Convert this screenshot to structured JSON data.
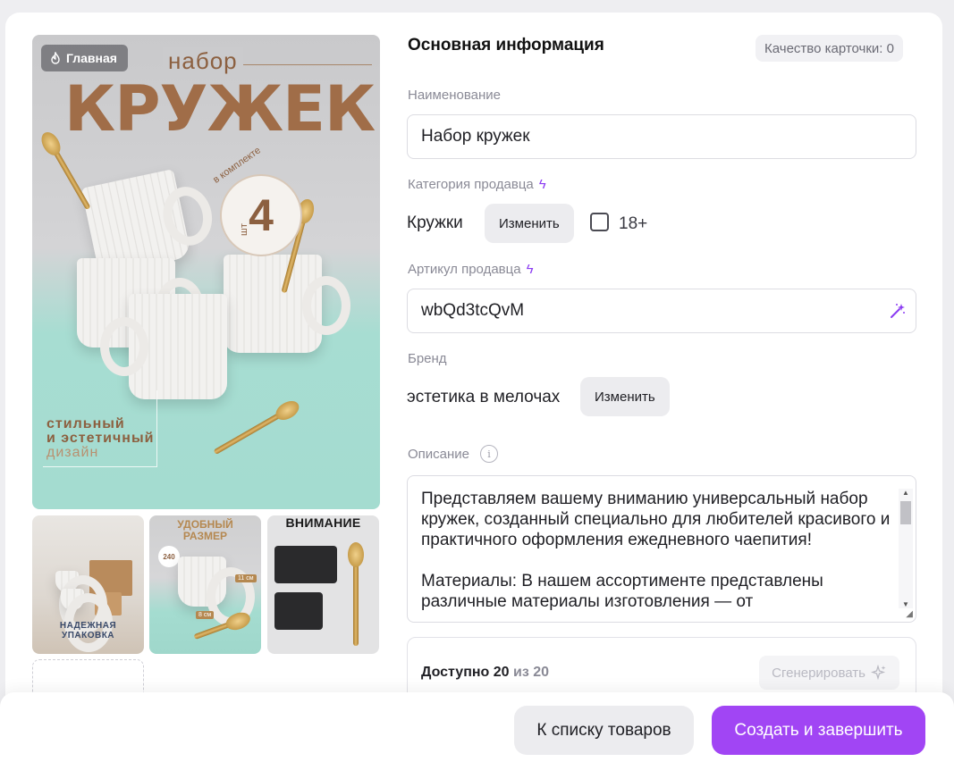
{
  "gallery": {
    "main_badge": "Главная",
    "promo": {
      "subtitle": "набор",
      "title": "КРУЖЕК",
      "count_arc": "в комплекте",
      "count_number": "4",
      "count_unit": "шт",
      "footer_line1": "стильный",
      "footer_line2": "и эстетичный",
      "footer_line3": "дизайн"
    },
    "thumbs": [
      {
        "caption": "НАДЕЖНАЯ УПАКОВКА"
      },
      {
        "caption_line1": "УДОБНЫЙ",
        "caption_line2": "РАЗМЕР",
        "dim1": "11 см",
        "dim2": "8 см",
        "badge": "240"
      },
      {
        "caption": "ВНИМАНИЕ"
      }
    ]
  },
  "form": {
    "section_title": "Основная информация",
    "quality_badge": "Качество карточки: 0",
    "name": {
      "label": "Наименование",
      "value": "Набор кружек"
    },
    "category": {
      "label": "Категория продавца",
      "value": "Кружки",
      "change_button": "Изменить",
      "adult_label": "18+"
    },
    "article": {
      "label": "Артикул продавца",
      "value": "wbQd3tcQvM"
    },
    "brand": {
      "label": "Бренд",
      "value": "эстетика в мелочах",
      "change_button": "Изменить"
    },
    "description": {
      "label": "Описание",
      "text": "Представляем вашему вниманию универсальный набор кружек, созданный специально для любителей красивого и практичного оформления ежедневного чаепития!\n\nМатериалы: В нашем ассортименте представлены различные материалы изготовления — от"
    },
    "generation": {
      "available_label": "Доступно",
      "available_count": "20",
      "of_label": "из",
      "total": "20",
      "button": "Сгенерировать"
    }
  },
  "footer": {
    "back_button": "К списку товаров",
    "create_button": "Создать и завершить"
  },
  "colors": {
    "accent": "#a145f4",
    "bolt": "#8b3cf2",
    "promo_brown": "#a06d48",
    "mint": "#a4dcd0"
  }
}
